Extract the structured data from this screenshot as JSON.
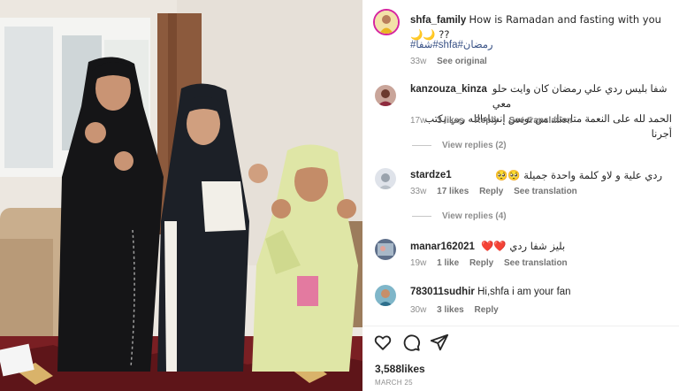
{
  "post": {
    "username": "shfa_family",
    "caption": "How is Ramadan and fasting with you 🌙🌙 ??",
    "hashtags": "#شفا#shfa#رمضان",
    "time": "33w",
    "see_original": "See original"
  },
  "comments": [
    {
      "username": "kanzouza_kinza",
      "text_line1": "شفا بليس ردي علي رمضان كان وايت حلو معي",
      "text_line2": "الحمد لله على النعمة متابعتك من تونس إنشاءالله ربي يكتب أجرنا",
      "time": "17w",
      "likes": "3 likes",
      "reply": "Reply",
      "translate": "See translation",
      "view_replies": "View replies (2)"
    },
    {
      "username": "stardze1",
      "text": "ردي علية و لاو كلمة واحدة جميلة 🥺🥺",
      "time": "33w",
      "likes": "17 likes",
      "reply": "Reply",
      "translate": "See translation",
      "view_replies": "View replies (4)"
    },
    {
      "username": "manar162021",
      "text": "بليز شفا ردي ❤️❤️",
      "time": "19w",
      "likes": "1 like",
      "reply": "Reply",
      "translate": "See translation"
    },
    {
      "username": "783011sudhir",
      "text": "Hi,shfa i am your fan",
      "time": "30w",
      "likes": "3 likes",
      "reply": "Reply"
    }
  ],
  "footer": {
    "likes": "3,588likes",
    "date": "MARCH 25"
  },
  "icons": [
    "heart-icon",
    "comment-icon",
    "share-icon"
  ],
  "colors": {
    "link": "#385185",
    "meta": "#8e8e8e",
    "text": "#262626"
  }
}
